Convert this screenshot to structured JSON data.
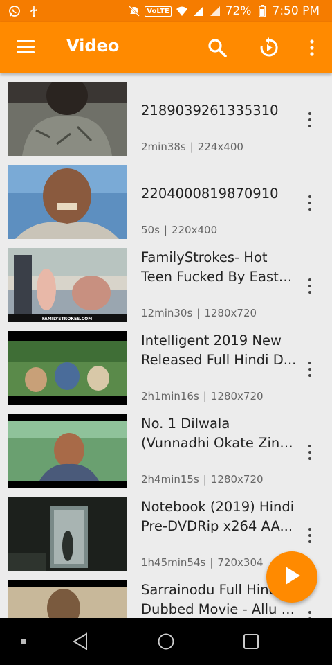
{
  "statusbar": {
    "volte": "VoLTE",
    "battery": "72%",
    "time": "7:50 PM"
  },
  "appbar": {
    "title": "Video",
    "icons": [
      "menu-icon",
      "search-icon",
      "refresh-icon",
      "more-vert-icon"
    ]
  },
  "videos": [
    {
      "line1": "2189039261335310",
      "line2": "",
      "duration": "2min38s",
      "resolution": "224x400"
    },
    {
      "line1": "2204000819870910",
      "line2": "",
      "duration": "50s",
      "resolution": "220x400"
    },
    {
      "line1": "FamilyStrokes- Hot",
      "line2": "Teen Fucked By Easte...",
      "duration": "12min30s",
      "resolution": "1280x720"
    },
    {
      "line1": "Intelligent 2019 New",
      "line2": "Released Full Hindi D...",
      "duration": "2h1min16s",
      "resolution": "1280x720"
    },
    {
      "line1": "No. 1 Dilwala",
      "line2": "(Vunnadhi Okate Zind...",
      "duration": "2h4min15s",
      "resolution": "1280x720"
    },
    {
      "line1": "Notebook (2019) Hindi",
      "line2": "Pre-DVDRip  x264 AA...",
      "duration": "1h45min54s",
      "resolution": "720x304"
    },
    {
      "line1": "Sarrainodu Full Hindi",
      "line2": "Dubbed Movie - Allu A...",
      "duration": "",
      "resolution": ""
    }
  ],
  "meta_separator": "|",
  "thumb_caption": "FAMILYSTROKES.COM",
  "colors": {
    "primary": "#ff8a00",
    "statusbar": "#f57c00",
    "background": "#ececec"
  }
}
